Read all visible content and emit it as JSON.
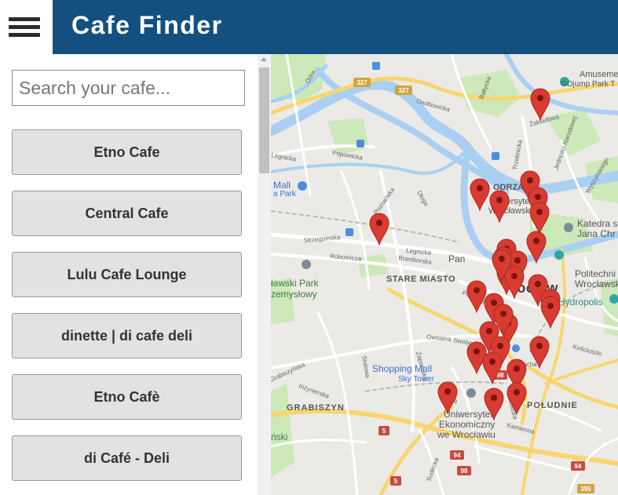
{
  "header": {
    "menu_icon": "hamburger-menu-icon",
    "title": "Cafe Finder",
    "background": "#135080"
  },
  "search": {
    "placeholder": "Search your cafe...",
    "value": ""
  },
  "cafes": [
    {
      "name": "Etno Cafe"
    },
    {
      "name": "Central Cafe"
    },
    {
      "name": "Lulu Cafe Lounge"
    },
    {
      "name": "dinette | di cafe deli"
    },
    {
      "name": "Etno Cafè"
    },
    {
      "name": "di Café - Deli"
    }
  ],
  "map": {
    "marker_color": "#d93b30",
    "roads": {
      "327_top": "327",
      "327_mid": "327",
      "98_a": "98",
      "98_b": "98",
      "5_a": "5",
      "5_b": "5",
      "94_a": "94",
      "94_b": "94",
      "395": "395"
    },
    "labels": {
      "odra": "Odra",
      "osobowicka": "Osobowicka",
      "baltycka": "Bałtycka",
      "zakladowa": "Zakładowa",
      "popowicka": "Popowicka",
      "legnicka_top": "Legnicka",
      "legnicka_mid": "Legnicka",
      "poznanska": "Poznańska",
      "dluga": "Długa",
      "trzebnicka": "Trzebnicka",
      "jednosci": "Jedności Narodowej",
      "wyszynskiego": "Wyszyńskiego",
      "strzegomska": "Strzegomska",
      "robotnicza": "Robotnicza",
      "braniborska": "Braniborska",
      "stare_miasto": "STARE MIASTO",
      "park1": "ławski Park",
      "park2": "zemysłowy",
      "mall1": "Mall",
      "mall2": "a Park",
      "odrza": "ODRZA",
      "uni1": "niwersytet",
      "uni2": "Wrocławski",
      "katedra1": "Katedra s",
      "katedra2": "Jana Chr",
      "amuseme": "Amuseme",
      "gojump": "GOjump Park T",
      "pan": "Pan",
      "wroclaw": "rocław",
      "politechnika1": "Politechni",
      "politechnika2": "Wrocławsk",
      "hydropolis": "Hydropolis",
      "podwale": "Podwale",
      "owsiana": "Owsiana",
      "swobodna": "Swobodna",
      "zaporoska": "Zaporoska",
      "stalowa": "Stalowa",
      "grabiszynska": "Grabiszyńska",
      "inzynierska": "Inżynierska",
      "sucha": "Sucha",
      "kosciuszki": "Kościuszki",
      "shopping1": "Shopping Mall",
      "shopping2": "Sky Tower",
      "wielka": "Wielka",
      "borowska": "Borowska",
      "grabiszyn": "GRABISZYN",
      "poludnie": "POŁUDNIE",
      "uekon1": "Uniwersytet",
      "uekon2": "Ekonomiczny",
      "uekon3": "we Wrocławiu",
      "kamienna": "Kamienna",
      "sudecka": "Sudecka",
      "nski": "ński"
    }
  }
}
